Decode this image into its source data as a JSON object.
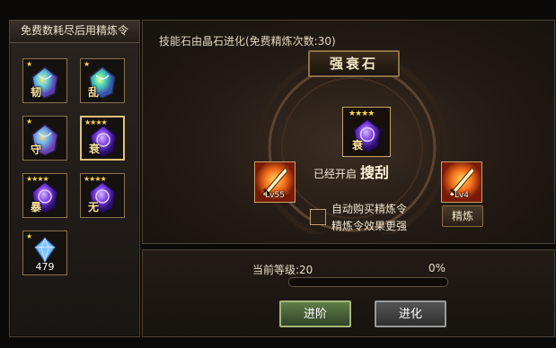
{
  "left_panel": {
    "title": "免费数耗尽后用精炼令",
    "gems": [
      {
        "char": "韧",
        "stars": "★",
        "color": "#7a7fe0",
        "icon": "rainbow-gem-icon"
      },
      {
        "char": "乱",
        "stars": "★",
        "color": "#6dd6c8",
        "icon": "rainbow-gem-icon"
      },
      {
        "char": "守",
        "stars": "★",
        "color": "#74a7e6",
        "icon": "rainbow-gem-icon"
      },
      {
        "char": "衰",
        "stars": "★★★★",
        "color": "#7b3fe0",
        "icon": "purple-gem-icon"
      },
      {
        "char": "暴",
        "stars": "★★★★",
        "color": "#7b3fe0",
        "icon": "purple-gem-icon"
      },
      {
        "char": "无",
        "stars": "★★★★",
        "color": "#7b3fe0",
        "icon": "purple-gem-icon"
      }
    ],
    "crystal": {
      "stars": "★",
      "count": "479",
      "icon": "crystal-icon"
    }
  },
  "main_panel": {
    "title": "技能石由晶石进化(免费精炼次数:30)",
    "banner": "强衰石",
    "center_gem": {
      "char": "衰",
      "stars": "★★★★"
    },
    "opened_label": "已经开启",
    "skill_name": "搜刮",
    "left_skill": {
      "lv": "Lv55",
      "icon": "sword-skill-icon"
    },
    "right_skill": {
      "lv": "Lv4",
      "icon": "sword-skill-icon"
    },
    "auto_line1": "自动购买精炼令",
    "auto_line2": "精炼令效果更强",
    "refine_button": "精炼"
  },
  "bottom_panel": {
    "level_label": "当前等级:20",
    "percent": "0%",
    "progress": 0,
    "advance_button": "进阶",
    "evolve_button": "进化"
  }
}
